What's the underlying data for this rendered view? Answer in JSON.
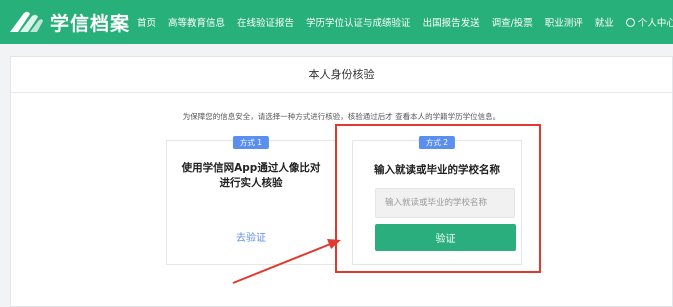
{
  "header": {
    "logo_text": "学信档案",
    "nav": [
      {
        "label": "首页"
      },
      {
        "label": "高等教育信息"
      },
      {
        "label": "在线验证报告"
      },
      {
        "label": "学历学位认证与成绩验证"
      },
      {
        "label": "出国报告发送"
      },
      {
        "label": "调查/投票"
      },
      {
        "label": "职业测评"
      },
      {
        "label": "就业"
      }
    ],
    "user_center": "个人中心",
    "user_center_caret": "▼"
  },
  "page": {
    "title": "本人身份核验",
    "notice": "为保障您的信息安全，请选择一种方式进行核验，核验通过后才 查看本人的学籍学历学位信息。"
  },
  "cards": {
    "app": {
      "badge": "方式 1",
      "title": "使用学信网App通过人像比对进行实人核验",
      "link": "去验证"
    },
    "school": {
      "badge": "方式 2",
      "title": "输入就读或毕业的学校名称",
      "input_value": "",
      "input_placeholder": "输入就读或毕业的学校名称",
      "button": "验证"
    }
  },
  "colors": {
    "brand_green": "#27b07a",
    "button_green": "#2aae7e",
    "link_blue": "#5a8ff0",
    "annotation_red": "#e03a2e"
  }
}
